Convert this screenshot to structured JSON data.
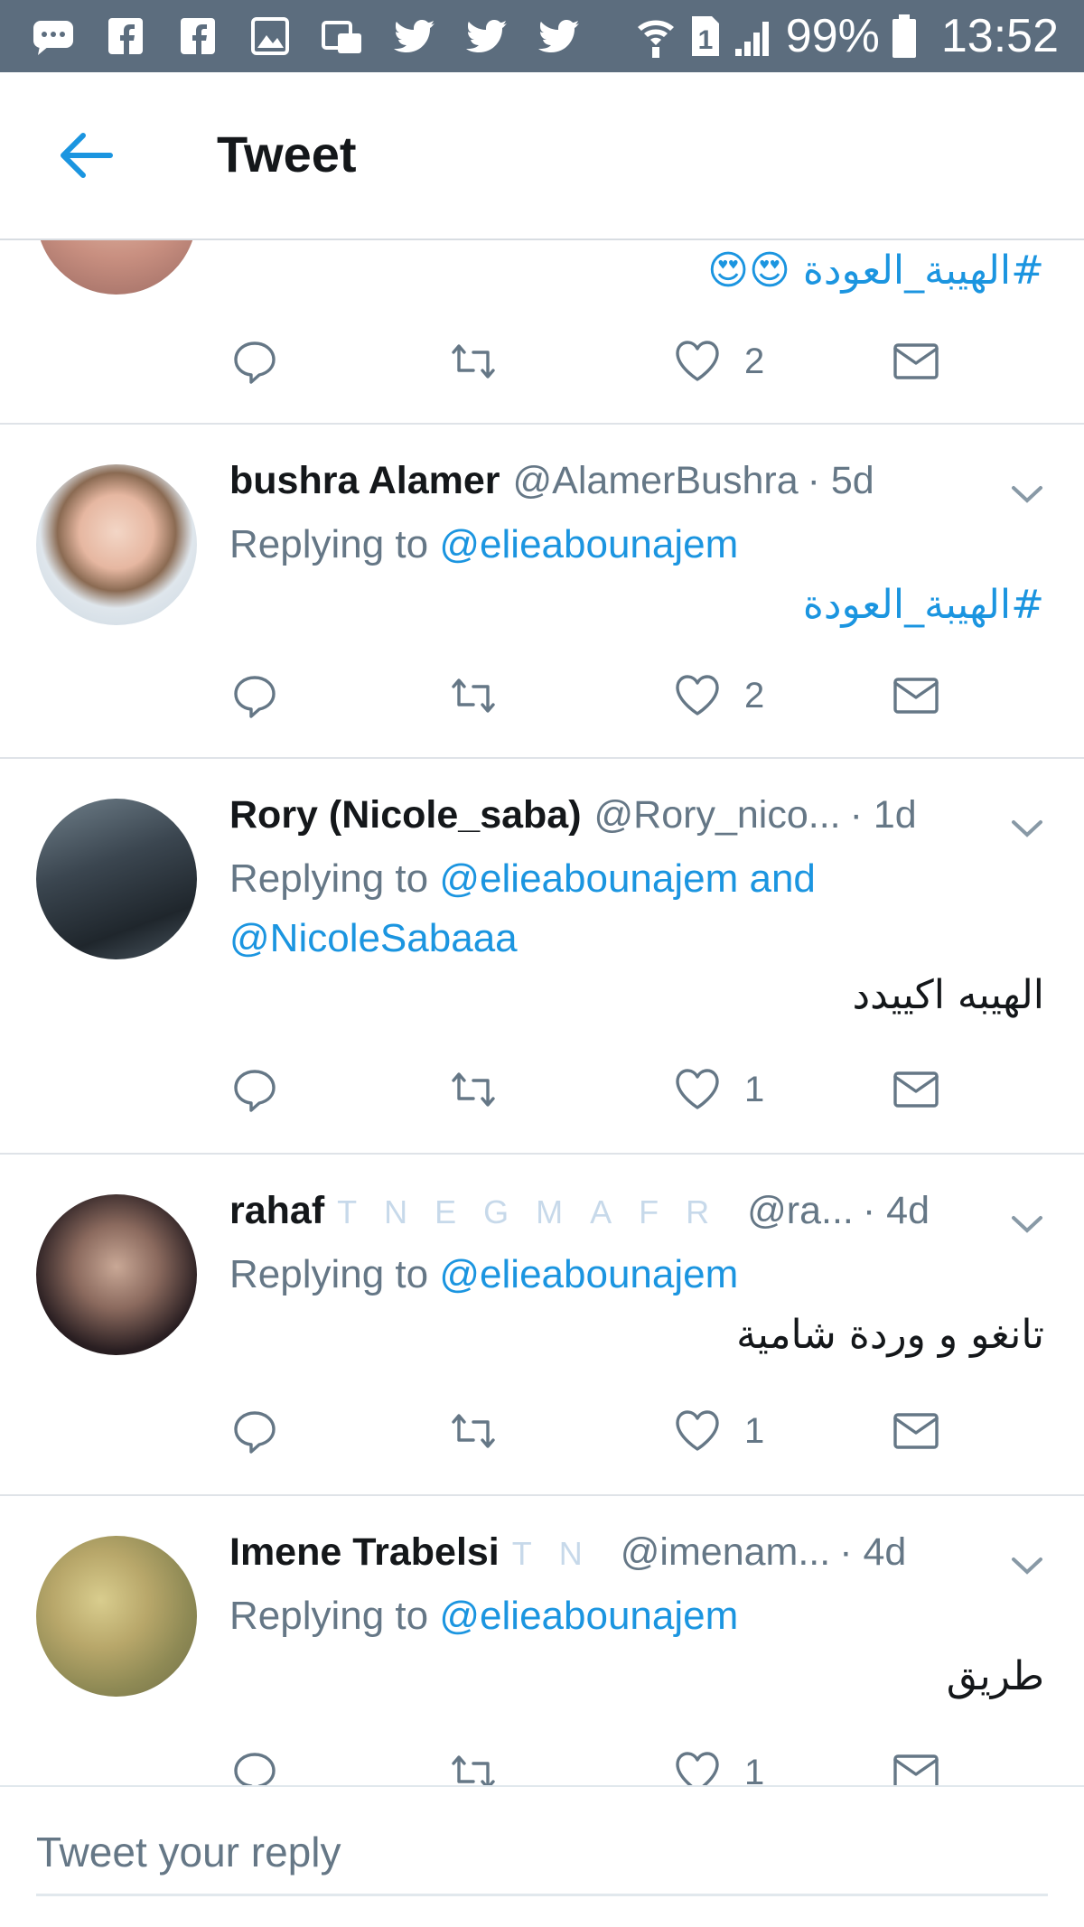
{
  "status_bar": {
    "battery": "99%",
    "time": "13:52",
    "icons": [
      "messenger-icon",
      "facebook-icon",
      "facebook-icon",
      "gallery-icon",
      "media-icon",
      "twitter-icon",
      "twitter-icon",
      "twitter-icon"
    ]
  },
  "header": {
    "title": "Tweet"
  },
  "colors": {
    "link": "#1b95e0",
    "muted": "#657786",
    "status_bar": "#5c6d7e"
  },
  "tweets": [
    {
      "text": "#الهيبة_العودة 😍😍",
      "likes": "2"
    },
    {
      "name": "bushra Alamer",
      "handle": "@AlamerBushra",
      "time": "· 5d",
      "replying_prefix": "Replying to",
      "replying_to": "@elieabounajem",
      "text": "#الهيبة_العودة",
      "likes": "2"
    },
    {
      "name": "Rory (Nicole_saba)",
      "handle": "@Rory_nico...",
      "time": "· 1d",
      "replying_prefix": "Replying to",
      "replying_to": "@elieabounajem and",
      "replying_to_2": "@NicoleSabaaa",
      "text": "الهيبه اكييدد",
      "likes": "1"
    },
    {
      "name": "rahaf",
      "name_decoration": "TNEGMAFR",
      "handle": "@ra...",
      "time": "· 4d",
      "replying_prefix": "Replying to",
      "replying_to": "@elieabounajem",
      "text": "تانغو و وردة شامية",
      "likes": "1"
    },
    {
      "name": "Imene Trabelsi",
      "name_decoration": "TN",
      "handle": "@imenam...",
      "time": "· 4d",
      "replying_prefix": "Replying to",
      "replying_to": "@elieabounajem",
      "text": "طريق",
      "likes": "1"
    }
  ],
  "composer": {
    "placeholder": "Tweet your reply"
  }
}
